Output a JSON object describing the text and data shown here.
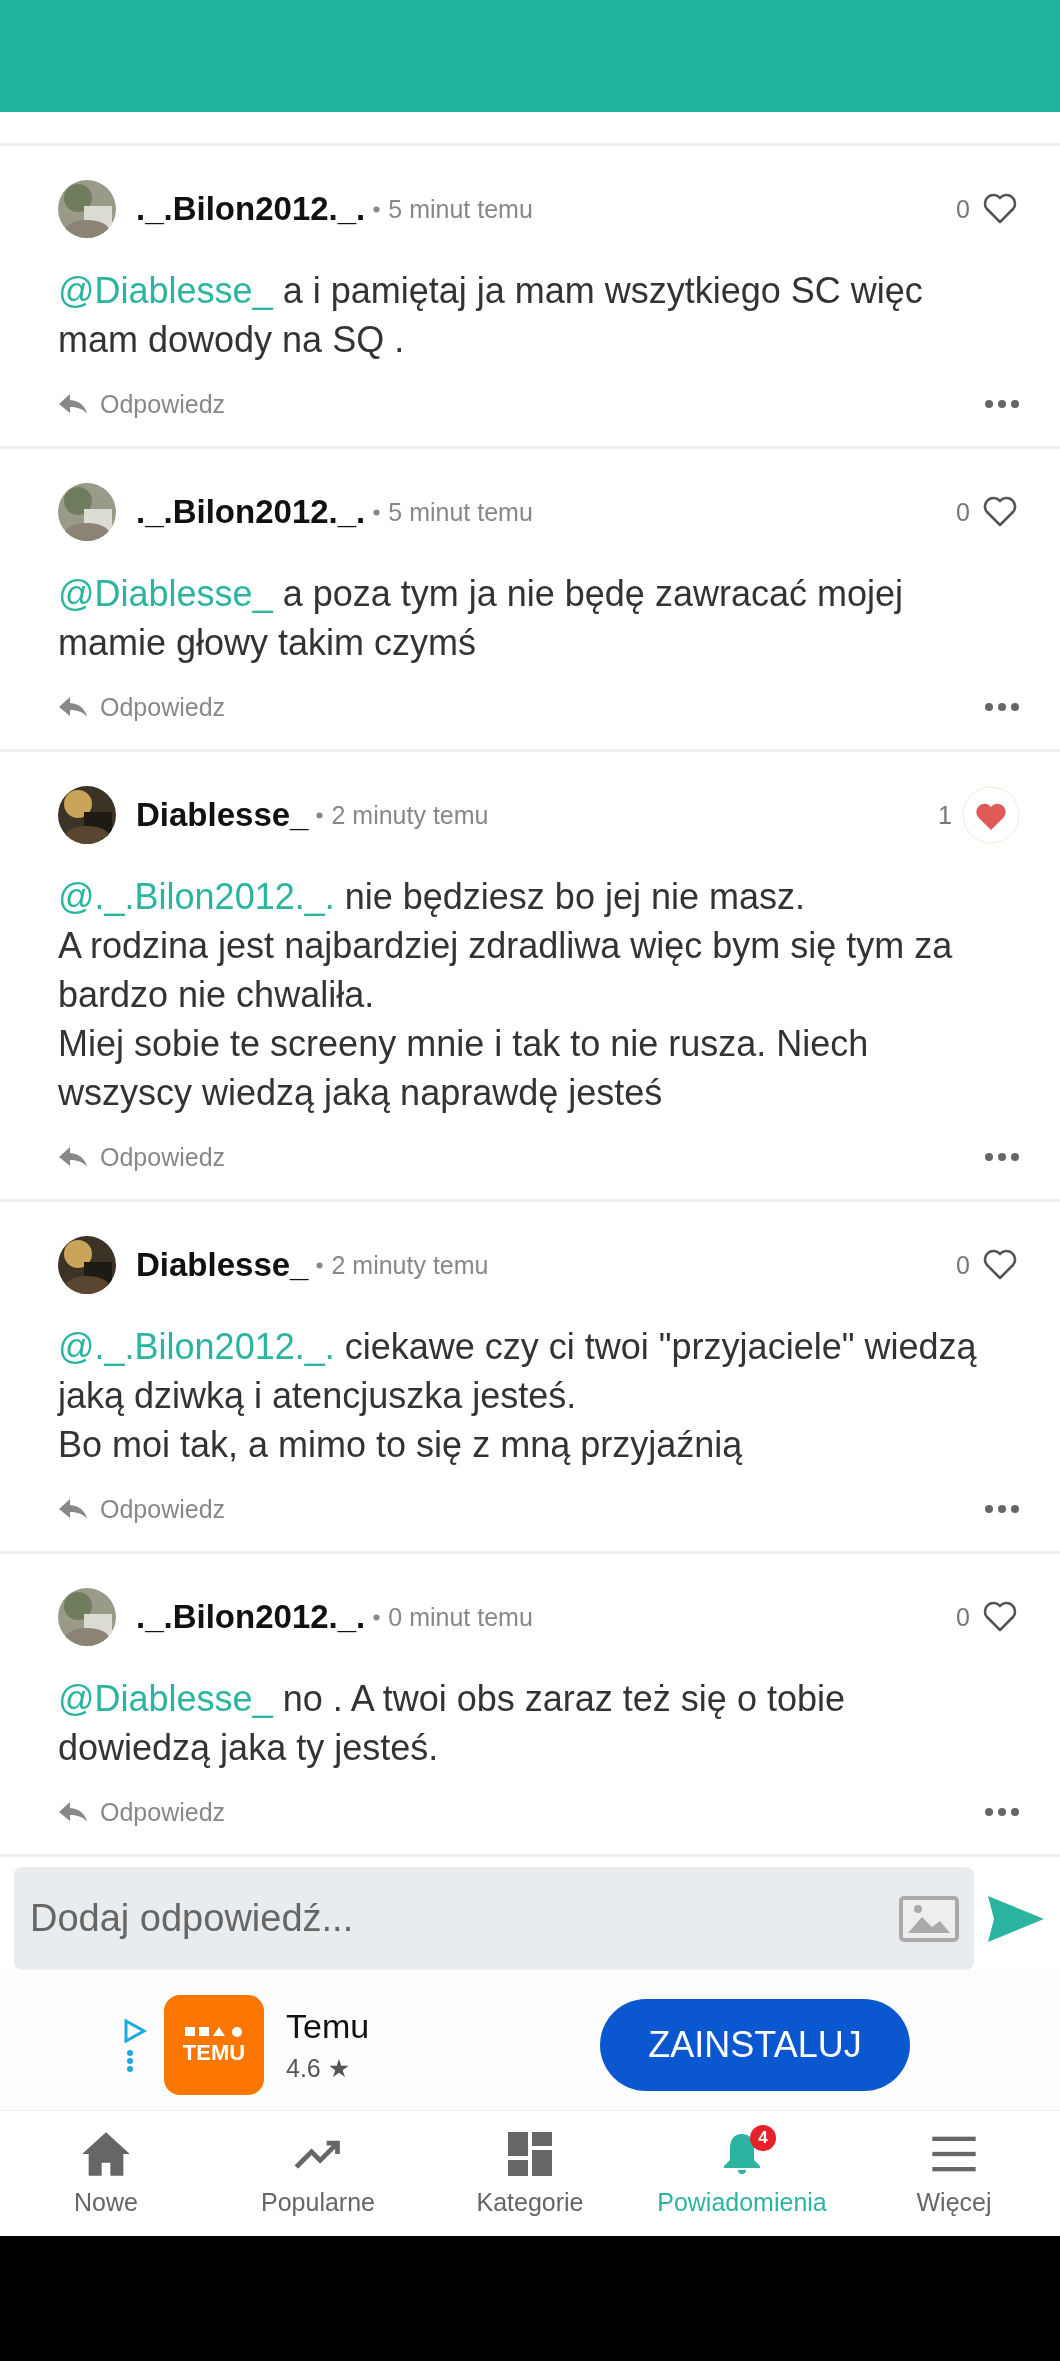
{
  "comments": [
    {
      "author": "._.Bilon2012._.",
      "time": "5 minut temu",
      "likes": "0",
      "liked": false,
      "mention": "@Diablesse_",
      "text": "a i pamiętaj ja mam wszytkiego SC więc mam dowody na SQ .",
      "reply": "Odpowiedz"
    },
    {
      "author": "._.Bilon2012._.",
      "time": "5 minut temu",
      "likes": "0",
      "liked": false,
      "mention": "@Diablesse_",
      "text": "a poza tym ja nie będę zawracać mojej mamie głowy takim czymś",
      "reply": "Odpowiedz"
    },
    {
      "author": "Diablesse_",
      "time": "2 minuty temu",
      "likes": "1",
      "liked": true,
      "mention": "@._.Bilon2012._.",
      "text": "nie będziesz bo jej nie masz.\nA rodzina jest najbardziej zdradliwa więc bym się tym za bardzo nie chwaliła.\nMiej sobie te screeny mnie i tak to nie rusza. Niech wszyscy wiedzą jaką naprawdę jesteś",
      "reply": "Odpowiedz"
    },
    {
      "author": "Diablesse_",
      "time": "2 minuty temu",
      "likes": "0",
      "liked": false,
      "mention": "@._.Bilon2012._.",
      "text": "ciekawe czy ci twoi \"przyjaciele\" wiedzą jaką dziwką i atencjuszka jesteś.\nBo moi tak, a mimo to się z mną przyjaźnią",
      "reply": "Odpowiedz"
    },
    {
      "author": "._.Bilon2012._.",
      "time": "0 minut temu",
      "likes": "0",
      "liked": false,
      "mention": "@Diablesse_",
      "text": "no . A twoi obs zaraz też się o tobie dowiedzą jaka ty jesteś.",
      "reply": "Odpowiedz"
    }
  ],
  "reply_input": {
    "placeholder": "Dodaj odpowiedź..."
  },
  "ad": {
    "logo": "TEMU",
    "name": "Temu",
    "rating": "4.6 ★",
    "button": "ZAINSTALUJ"
  },
  "nav": [
    {
      "kind": "home",
      "label": "Nowe",
      "selected": false
    },
    {
      "kind": "trending",
      "label": "Popularne",
      "selected": false
    },
    {
      "kind": "grid",
      "label": "Kategorie",
      "selected": false
    },
    {
      "kind": "bell",
      "label": "Powiadomienia",
      "selected": true,
      "badge": "4"
    },
    {
      "kind": "menu",
      "label": "Więcej",
      "selected": false
    }
  ]
}
